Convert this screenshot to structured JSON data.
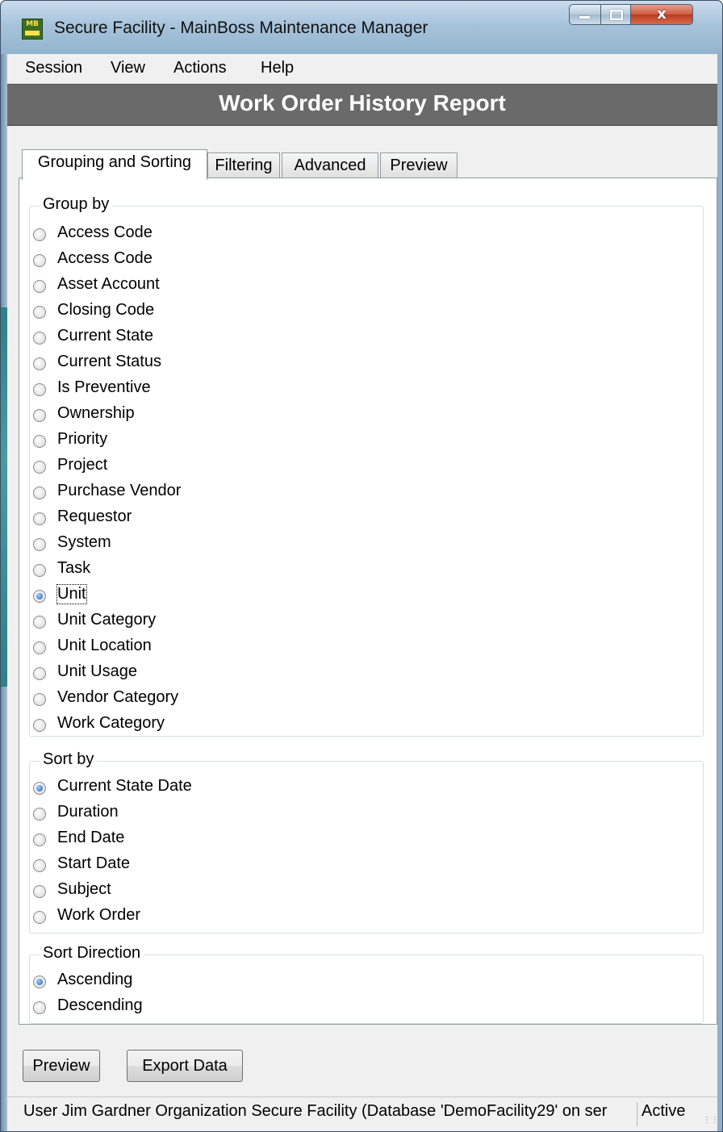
{
  "window": {
    "title": "Secure Facility - MainBoss Maintenance Manager",
    "icon_text": "MB",
    "controls": {
      "minimize": "minimize",
      "maximize": "maximize",
      "close": "x"
    }
  },
  "menu": [
    "Session",
    "View",
    "Actions",
    "Help"
  ],
  "report": {
    "title": "Work Order History Report"
  },
  "tabs": [
    {
      "label": "Grouping and Sorting",
      "active": true
    },
    {
      "label": "Filtering",
      "active": false
    },
    {
      "label": "Advanced",
      "active": false
    },
    {
      "label": "Preview",
      "active": false
    }
  ],
  "group_by": {
    "label": "Group by",
    "selected": "Unit",
    "options": [
      "Access Code",
      "Access Code",
      "Asset Account",
      "Closing Code",
      "Current State",
      "Current Status",
      "Is Preventive",
      "Ownership",
      "Priority",
      "Project",
      "Purchase Vendor",
      "Requestor",
      "System",
      "Task",
      "Unit",
      "Unit Category",
      "Unit Location",
      "Unit Usage",
      "Vendor Category",
      "Work Category"
    ]
  },
  "sort_by": {
    "label": "Sort by",
    "selected": "Current State Date",
    "options": [
      "Current State Date",
      "Duration",
      "End Date",
      "Start Date",
      "Subject",
      "Work Order"
    ]
  },
  "sort_direction": {
    "label": "Sort Direction",
    "selected": "Ascending",
    "options": [
      "Ascending",
      "Descending"
    ]
  },
  "buttons": {
    "preview": "Preview",
    "export": "Export Data"
  },
  "status": {
    "info": "User Jim Gardner Organization Secure Facility (Database 'DemoFacility29' on ser",
    "state": "Active"
  },
  "colors": {
    "report_header_bg": "#6a6a6a",
    "accent": "#1d5fb8",
    "titlebar": "#a7c3db"
  }
}
